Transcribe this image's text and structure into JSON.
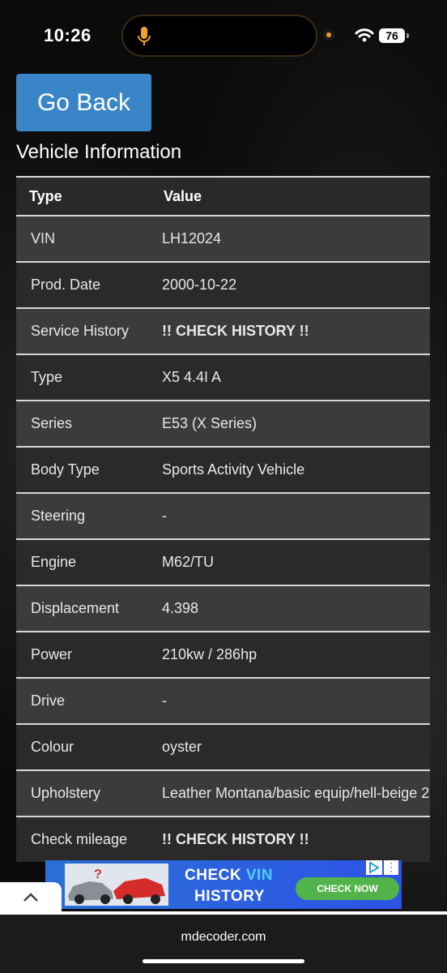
{
  "status_bar": {
    "time": "10:26",
    "battery": "76"
  },
  "page": {
    "back_label": "Go Back",
    "section_title": "Vehicle Information"
  },
  "table": {
    "headers": [
      "Type",
      "Value"
    ],
    "rows": [
      {
        "label": "VIN",
        "value": "LH12024"
      },
      {
        "label": "Prod. Date",
        "value": "2000-10-22"
      },
      {
        "label": "Service History",
        "value": "!! CHECK HISTORY !!",
        "warning": true
      },
      {
        "label": "Type",
        "value": "X5 4.4I A"
      },
      {
        "label": "Series",
        "value": "E53 (X Series)"
      },
      {
        "label": "Body Type",
        "value": "Sports Activity Vehicle"
      },
      {
        "label": "Steering",
        "value": "-"
      },
      {
        "label": "Engine",
        "value": "M62/TU"
      },
      {
        "label": "Displacement",
        "value": "4.398"
      },
      {
        "label": "Power",
        "value": "210kw / 286hp"
      },
      {
        "label": "Drive",
        "value": "-"
      },
      {
        "label": "Colour",
        "value": "oyster"
      },
      {
        "label": "Upholstery",
        "value": "Leather Montana/basic equip/hell-beige 2"
      },
      {
        "label": "Check mileage",
        "value": "!! CHECK HISTORY !!",
        "warning": true
      }
    ]
  },
  "ad": {
    "line1_a": "CHECK ",
    "line1_b": "VIN",
    "line2": "HISTORY",
    "button": "CHECK NOW"
  },
  "browser": {
    "url": "mdecoder.com"
  },
  "colors": {
    "button": "#3a85c8",
    "warning": "#e03a2f",
    "row_odd": "#3b3b3b",
    "row_even": "#2a2a2a"
  }
}
